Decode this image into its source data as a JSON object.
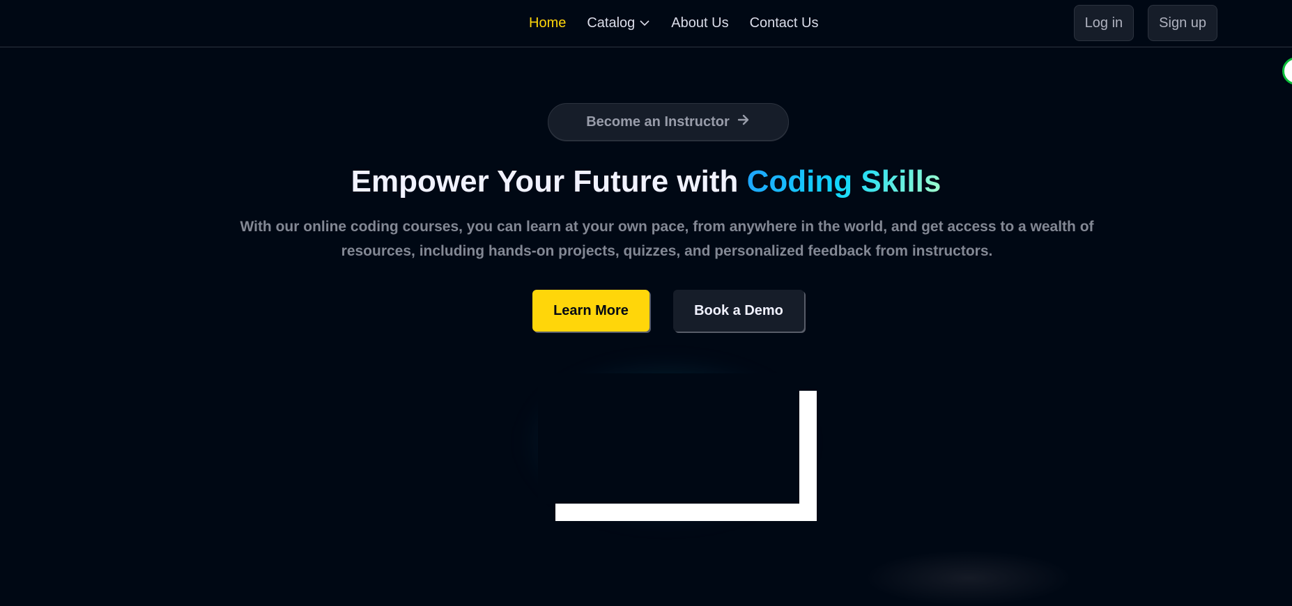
{
  "nav": {
    "links": [
      {
        "label": "Home",
        "active": true
      },
      {
        "label": "Catalog",
        "icon": "chevron-down-icon"
      },
      {
        "label": "About Us"
      },
      {
        "label": "Contact Us"
      }
    ],
    "login_label": "Log in",
    "signup_label": "Sign up"
  },
  "hero": {
    "instructor_label": "Become an Instructor",
    "instructor_icon": "arrow-right-icon",
    "headline_plain": "Empower Your Future with ",
    "headline_highlight": "Coding Skills",
    "subtitle": "With our online coding courses, you can learn at your own pace, from anywhere in the world, and get access to a wealth of resources, including hands-on projects, quizzes, and personalized feedback from instructors.",
    "learn_more_label": "Learn More",
    "book_demo_label": "Book a Demo"
  },
  "colors": {
    "background": "#000814",
    "accent_yellow": "#ffd60a",
    "highlight_gradient": [
      "#1fa2ff",
      "#12d8fa",
      "#a6ffcb"
    ]
  }
}
